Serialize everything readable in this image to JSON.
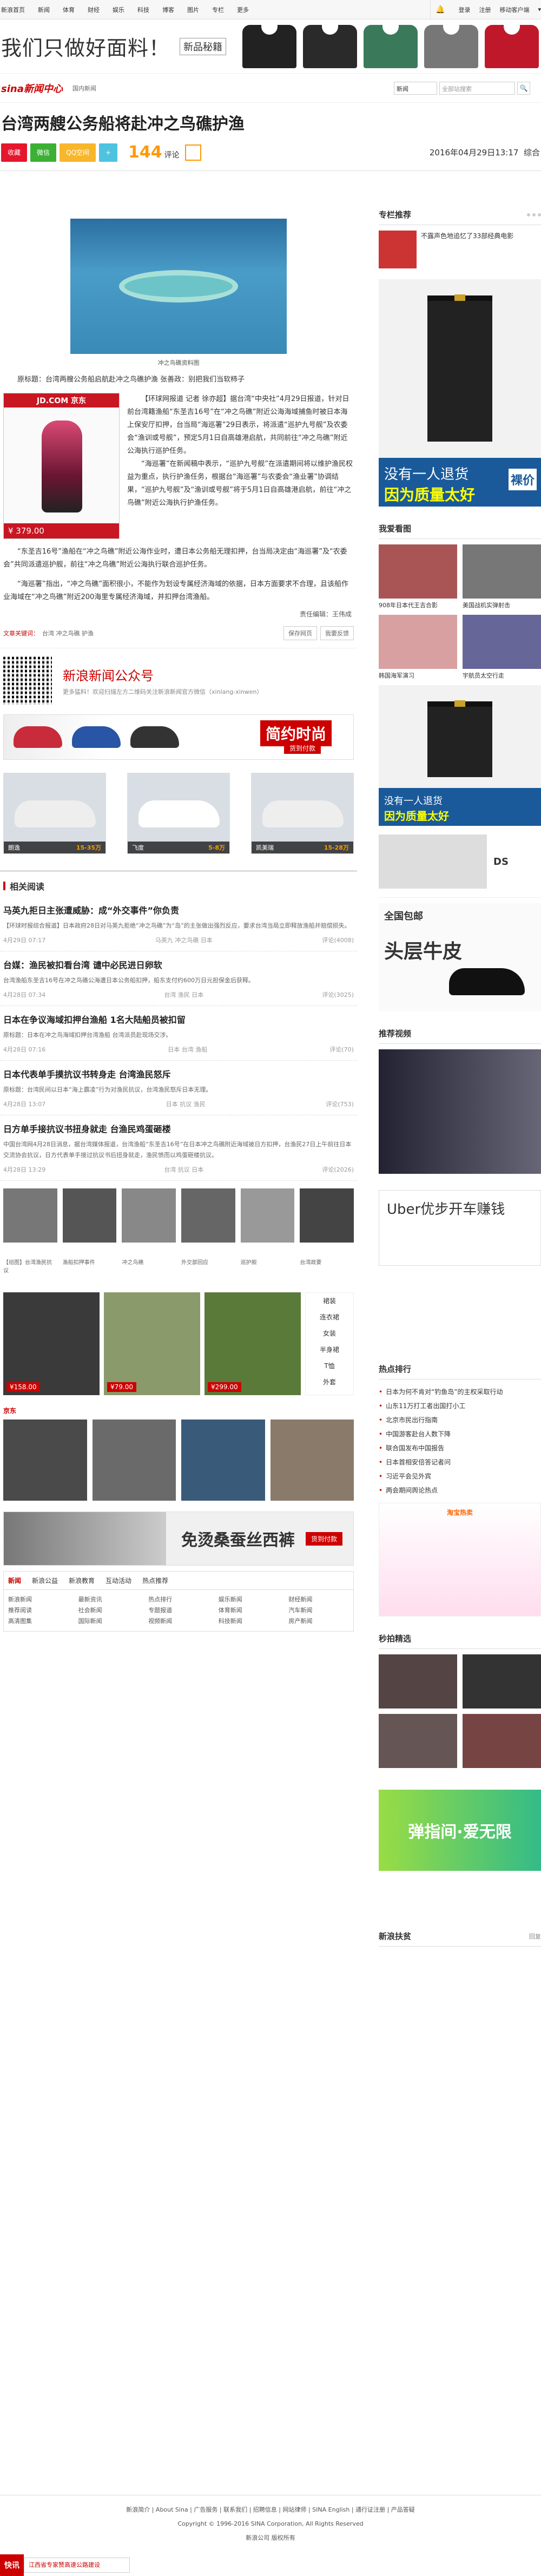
{
  "topnav": {
    "links": [
      "新浪首页",
      "新闻",
      "体育",
      "财经",
      "娱乐",
      "科技",
      "博客",
      "图片",
      "专栏",
      "更多"
    ],
    "login": "登录",
    "register": "注册",
    "mobile": "移动客户端"
  },
  "ad_banner": {
    "slogan": "我们只做好面料！",
    "tag": "新品秘籍",
    "shirt_colors": [
      "#222222",
      "#2a2a2a",
      "#3a7a5a",
      "#777777",
      "#c0182b"
    ]
  },
  "header": {
    "logo": "sina新闻中心",
    "crumb": "国内新闻",
    "search_select": "新闻",
    "search_placeholder": "全部站搜索"
  },
  "article": {
    "title": "台湾两艘公务船将赴冲之鸟礁护渔",
    "share": [
      "收藏",
      "微信",
      "QQ空间"
    ],
    "comments": "144",
    "comments_unit": "评论",
    "date": "2016年04月29日13:17",
    "source": "综合",
    "img_caption": "冲之鸟礁资料图",
    "intro": "原标题：台湾两艘公务船启航赴冲之鸟礁护渔 张善政：别把我们当软柿子",
    "jd_ad": {
      "brand": "JD.COM 京东",
      "price": "¥ 379.00"
    },
    "p1": "【环球网报道 记者 徐亦超】据台湾“中央社”4月29日报道，针对日前台湾籍渔船“东圣吉16号”在“冲之鸟礁”附近公海海域捕鱼时被日本海上保安厅扣押，台当局“海巡署”29日表示，将派遣“巡护九号舰”及农委会“渔训或号舰”，预定5月1日自高雄港启航，共同前往“冲之鸟礁”附近公海执行巡护任务。",
    "p2": "“海巡署”在新闻稿中表示，“巡护九号舰”在派遣期间将以维护渔民权益为重点，执行护渔任务，根据台“海巡署”与农委会“渔业署”协调结果，“巡护九号舰”及“渔训或号舰”将于5月1日自高雄港启航，前往“冲之鸟礁”附近公海执行护渔任务。",
    "p3": "“东圣吉16号”渔船在“冲之鸟礁”附近公海作业时，遭日本公务船无理扣押，台当局决定由“海巡署”及“农委会”共同派遣巡护舰，前往“冲之鸟礁”附近公海执行联合巡护任务。",
    "p4": "“海巡署”指出，“冲之鸟礁”面积很小，不能作为划设专属经济海域的依据，日本方面要求不合理，且该船作业海域在“冲之鸟礁”附近200海里专属经济海域，并扣押台湾渔船。",
    "editor": "责任编辑：王伟成",
    "tags_label": "文章关键词：",
    "tags": "台湾  冲之鸟礁  护渔",
    "btn_save": "保存网页",
    "btn_feedback": "我要反馈"
  },
  "wechat": {
    "title": "新浪新闻公众号",
    "sub": "更多猛料！欢迎扫描左方二维码关注新浪新闻官方微信（xinlang-xinwen）"
  },
  "shoe_ad": {
    "text": "简约时尚",
    "btn": "货到付款"
  },
  "cars": [
    {
      "name": "朗逸",
      "price": "15-35万"
    },
    {
      "name": "飞度",
      "price": "5-8万"
    },
    {
      "name": "凯美瑞",
      "price": "15-28万"
    }
  ],
  "related": {
    "title": "相关阅读",
    "items": [
      {
        "h": "马英九拒日主张遭威胁：成“外交事件”你负责",
        "p": "【环球时报综合报道】日本政府28日对马英九拒绝“冲之鸟礁”为“岛”的主张做出强烈反应，要求台湾当局立即释放渔船并赔偿损失。",
        "date": "4月29日 07:17",
        "src": "马英九 冲之鸟礁 日本",
        "n": "评论(4008)"
      },
      {
        "h": "台媒：渔民被扣看台湾 谴中必民进日卵软",
        "p": "台湾渔船东圣吉16号在冲之鸟礁公海遭日本公务船扣押，船东支付约600万日元担保金后获释。",
        "date": "4月28日 07:34",
        "src": "台湾 渔民 日本",
        "n": "评论(3025)"
      },
      {
        "h": "日本在争议海域扣押台渔船 1名大陆船员被扣留",
        "p": "原标题：日本在冲之鸟海域扣押台湾渔船 台湾派员赴现场交涉。",
        "date": "4月28日 07:16",
        "src": "日本 台湾 渔船",
        "n": "评论(70)"
      },
      {
        "h": "日本代表单手摸抗议书转身走 台湾渔民怒斥",
        "p": "原标题：台湾民间以日本“海上霸凌”行为对渔民抗议，台湾渔民怒斥日本无理。",
        "date": "4月28日 13:07",
        "src": "日本 抗议 渔民",
        "n": "评论(753)"
      },
      {
        "h": "日方单手接抗议书扭身就走 台渔民鸡蛋砸楼",
        "p": "中国台湾网4月28日消息，据台湾媒体报道，台湾渔船“东圣吉16号”在日本冲之鸟礁附近海域被日方扣押，台渔民27日上午前往日本交流协会抗议，日方代表单手接过抗议书后扭身就走，渔民愤而以鸡蛋砸楼抗议。",
        "date": "4月28日 13:29",
        "src": "台湾 抗议 日本",
        "n": "评论(2026)"
      }
    ]
  },
  "photos_caption": [
    "【组图】台湾渔民抗议",
    "渔船扣押事件",
    "冲之鸟礁",
    "外交部回应",
    "巡护舰",
    "台湾政要"
  ],
  "taobao": {
    "prices": [
      "¥158.00",
      "¥79.00",
      "¥299.00"
    ],
    "side": [
      "裙装",
      "连衣裙",
      "女装",
      "半身裙",
      "T恤",
      "外套"
    ]
  },
  "jd": {
    "label": "京东"
  },
  "belt_ad": {
    "text": "免烫桑蚕丝西裤",
    "btn": "货到付款"
  },
  "linktab": {
    "tabs": [
      "新闻",
      "新浪公益",
      "新浪教育",
      "互动活动",
      "热点推荐"
    ],
    "cols": [
      [
        "新浪新闻",
        "推荐阅读",
        "高清图集"
      ],
      [
        "最新资讯",
        "社会新闻",
        "国际新闻"
      ],
      [
        "热点排行",
        "专题报道",
        "视频新闻"
      ],
      [
        "娱乐新闻",
        "体育新闻",
        "科技新闻"
      ],
      [
        "财经新闻",
        "汽车新闻",
        "房产新闻"
      ]
    ]
  },
  "side": {
    "rec": "专栏推荐",
    "rec_text": "不露声色地追忆了33部经典电影",
    "pants_s1": "没有一人退货",
    "pants_s2": "因为质量太好",
    "pants_tag": "裸价",
    "mylike": "我爱看图",
    "mylike_items": [
      "908年日本代王吉合影",
      "美国战机实弹射击",
      "韩国海军演习",
      "宇航员太空行走"
    ],
    "ads2": "DS",
    "shoe_brand": "全国包邮",
    "shoe_big": "头层牛皮",
    "video": "推荐视频",
    "uber": "Uber优步开车赚钱",
    "hot": "热点排行",
    "hot_items": [
      "日本为何不肯对“钓鱼岛”的主权采取行动",
      "山东11万打工者出国打小工",
      "北京市民出行指南",
      "中国游客赴台人数下降",
      "联合国发布中国报告",
      "日本首相安倍答记者问",
      "习近平会见外宾",
      "两会期间舆论热点"
    ],
    "tb": "淘宝热卖",
    "sec": "秒拍精选",
    "game": "弹指间·爱无限",
    "bottom_hd": "新浪扶贫",
    "bottom_more": "回复"
  },
  "footer": {
    "line1": "新浪简介 | About Sina | 广告服务 | 联系我们 | 招聘信息 | 网站律师 | SINA English | 通行证注册 | 产品答疑",
    "line2": "Copyright © 1996-2016 SINA Corporation, All Rights Reserved",
    "line3": "新浪公司 版权所有"
  },
  "bottombar": {
    "logo": "快讯",
    "text": "江西省专家赞高速公路建设"
  }
}
